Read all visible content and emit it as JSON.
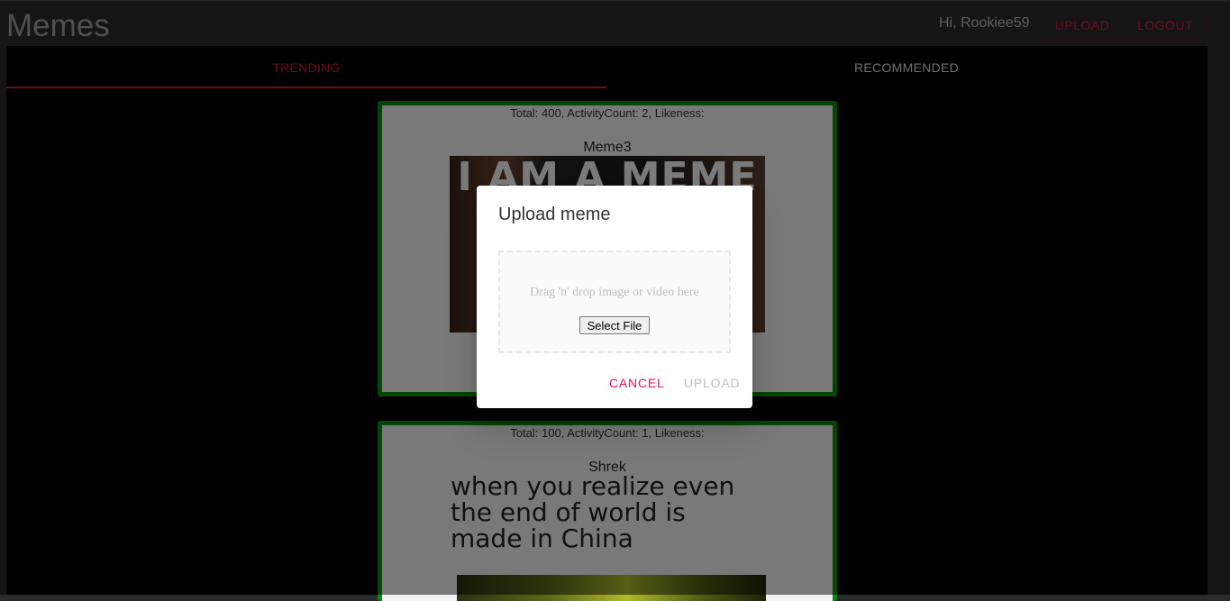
{
  "header": {
    "title": "Memes",
    "greeting": "Hi, Rookiee59",
    "upload_label": "UPLOAD",
    "logout_label": "LOGOUT"
  },
  "tabs": [
    {
      "label": "TRENDING",
      "active": true
    },
    {
      "label": "RECOMMENDED",
      "active": false
    }
  ],
  "colors": {
    "accent": "#d81b3c",
    "card_border": "#0a8a0a",
    "cancel": "#e0105a"
  },
  "cards": [
    {
      "stats": "Total: 400, ActivityCount: 2, Likeness:",
      "title": "Meme3",
      "image_caption": "I AM A MEME"
    },
    {
      "stats": "Total: 100, ActivityCount: 1, Likeness:",
      "title": "Shrek",
      "image_text": "when you realize even the end of world is made in China"
    }
  ],
  "dialog": {
    "title": "Upload meme",
    "dropzone_text": "Drag 'n' drop image or video here",
    "select_file_label": "Select File",
    "cancel_label": "CANCEL",
    "upload_label": "UPLOAD"
  }
}
